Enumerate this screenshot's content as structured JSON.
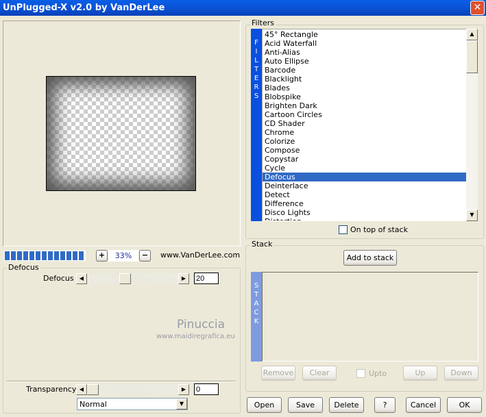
{
  "window": {
    "title": "UnPlugged-X v2.0 by VanDerLee",
    "close_icon": "close-icon"
  },
  "preview": {
    "zoom": "33%",
    "plus": "+",
    "minus": "−",
    "website": "www.VanDerLee.com",
    "progress_segments": 13
  },
  "params": {
    "group_label": "Defocus",
    "defocus_label": "Defocus",
    "defocus_value": "20",
    "defocus_max": 100,
    "transparency_label": "Transparency",
    "transparency_value": "0",
    "blend_mode": "Normal"
  },
  "watermark": {
    "name": "Pinuccia",
    "url": "www.maidiregrafica.eu"
  },
  "filters": {
    "group_label": "Filters",
    "strip_letters": [
      "F",
      "I",
      "L",
      "T",
      "E",
      "R",
      "S"
    ],
    "items": [
      "45° Rectangle",
      "Acid Waterfall",
      "Anti-Alias",
      "Auto Ellipse",
      "Barcode",
      "Blacklight",
      "Blades",
      "Blobspike",
      "Brighten Dark",
      "Cartoon Circles",
      "CD Shader",
      "Chrome",
      "Colorize",
      "Compose",
      "Copystar",
      "Cycle",
      "Defocus",
      "Deinterlace",
      "Detect",
      "Difference",
      "Disco Lights",
      "Distortion"
    ],
    "selected": "Defocus",
    "on_top_label": "On top of stack",
    "on_top_checked": false
  },
  "stack": {
    "group_label": "Stack",
    "add_label": "Add to stack",
    "strip_letters": [
      "S",
      "T",
      "A",
      "C",
      "K"
    ],
    "remove": "Remove",
    "clear": "Clear",
    "upto": "Upto",
    "up": "Up",
    "down": "Down"
  },
  "buttons": {
    "open": "Open",
    "save": "Save",
    "delete": "Delete",
    "help": "?",
    "cancel": "Cancel",
    "ok": "OK"
  },
  "colors": {
    "accent": "#0a5fe8",
    "selection": "#316ac5",
    "stack_strip": "#7f9be0"
  }
}
